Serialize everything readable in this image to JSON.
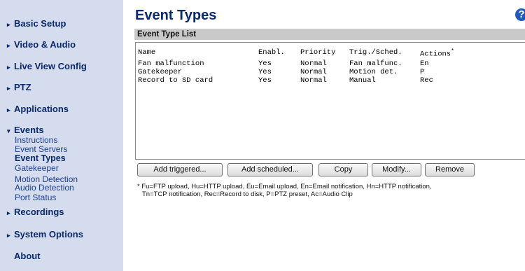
{
  "sidebar": {
    "items": [
      {
        "label": "Basic Setup",
        "marker": "▸"
      },
      {
        "label": "Video & Audio",
        "marker": "▸"
      },
      {
        "label": "Live View Config",
        "marker": "▸"
      },
      {
        "label": "PTZ",
        "marker": "▸"
      },
      {
        "label": "Applications",
        "marker": "▸"
      },
      {
        "label": "Events",
        "marker": "▾"
      },
      {
        "label": "Recordings",
        "marker": "▸"
      },
      {
        "label": "System Options",
        "marker": "▸"
      },
      {
        "label": "About",
        "marker": ""
      }
    ],
    "events_sub": [
      "Instructions",
      "Event Servers",
      "Event Types",
      "Gatekeeper",
      "Motion Detection",
      "Audio Detection",
      "Port Status"
    ]
  },
  "main": {
    "title": "Event Types",
    "help_icon": "?",
    "list_title": "Event Type List",
    "columns": [
      "Name",
      "Enabl.",
      "Priority",
      "Trig./Sched.",
      "Actions"
    ],
    "actions_sup": "*",
    "rows": [
      [
        "Fan malfunction",
        "Yes",
        "Normal",
        "Fan malfunc.",
        "En"
      ],
      [
        "Gatekeeper",
        "Yes",
        "Normal",
        "Motion det.",
        "P"
      ],
      [
        "Record to SD card",
        "Yes",
        "Normal",
        "Manual",
        "Rec"
      ]
    ],
    "buttons": {
      "add_triggered": "Add triggered...",
      "add_scheduled": "Add scheduled...",
      "copy": "Copy",
      "modify": "Modify...",
      "remove": "Remove"
    },
    "footnote": {
      "line1": "* Fu=FTP upload, Hu=HTTP upload, Eu=Email upload, En=Email notification, Hn=HTTP notification,",
      "line2": "Tn=TCP notification, Rec=Record to disk, P=PTZ preset, Ac=Audio Clip"
    }
  },
  "colors": {
    "sidebar_bg": "#d4dcee",
    "nav_text": "#0a2a6b",
    "header_bar": "#c9c9c9",
    "help_icon": "#1f5bbf"
  }
}
